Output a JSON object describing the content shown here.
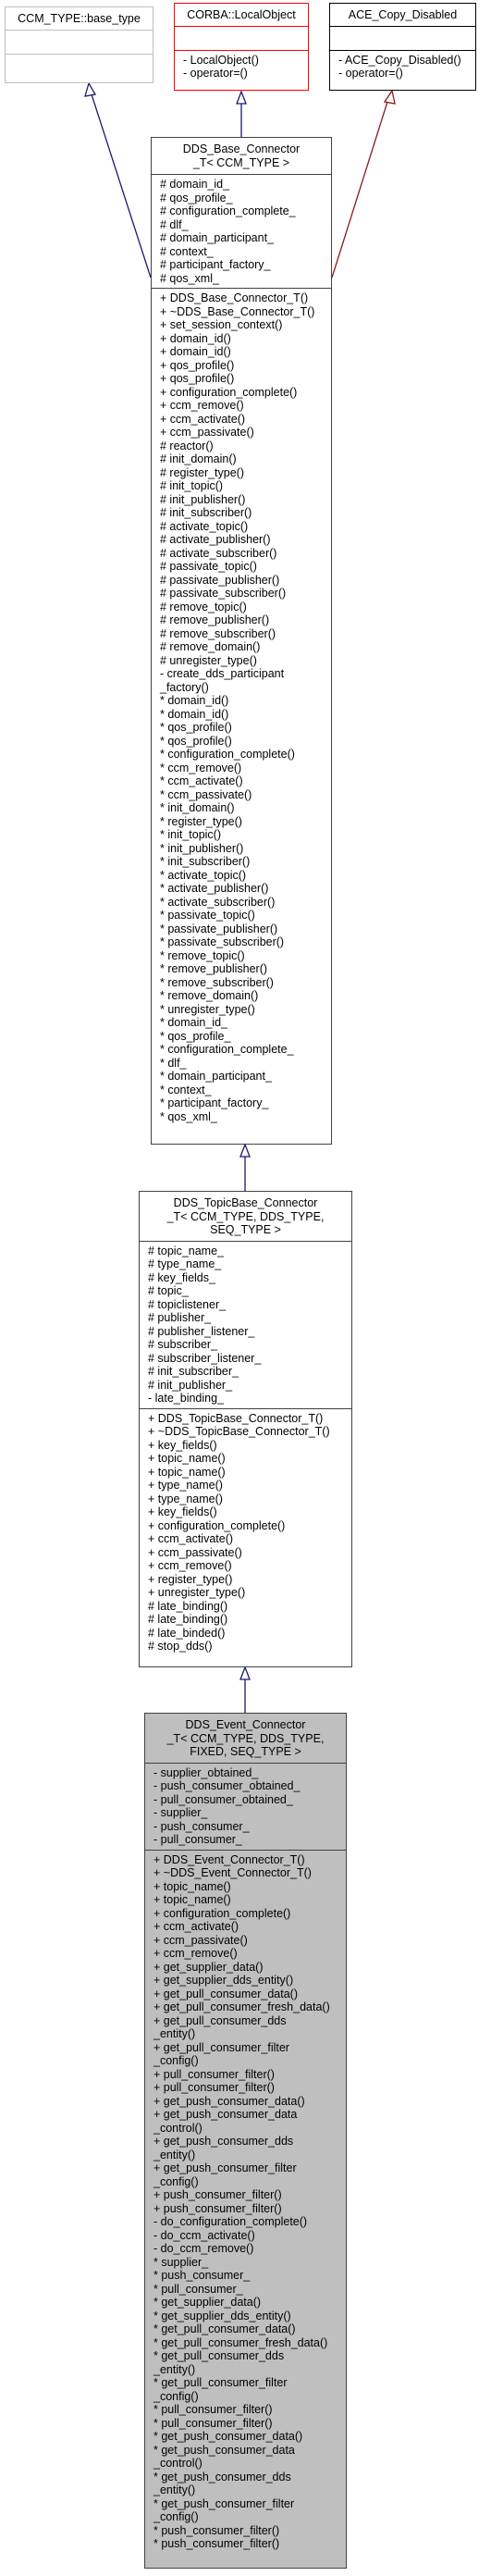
{
  "classes": {
    "base_type": {
      "title": "CCM_TYPE::base_type",
      "attributes": [],
      "methods": []
    },
    "local_object": {
      "title": "CORBA::LocalObject",
      "attributes": [],
      "methods": [
        "- LocalObject()",
        "- operator=()"
      ]
    },
    "copy_disabled": {
      "title": "ACE_Copy_Disabled",
      "attributes": [],
      "methods": [
        "- ACE_Copy_Disabled()",
        "- operator=()"
      ]
    },
    "base_connector": {
      "title": "DDS_Base_Connector\n_T< CCM_TYPE >",
      "attributes": [
        "# domain_id_",
        "# qos_profile_",
        "# configuration_complete_",
        "# dlf_",
        "# domain_participant_",
        "# context_",
        "# participant_factory_",
        "# qos_xml_"
      ],
      "methods": [
        "+ DDS_Base_Connector_T()",
        "+ ~DDS_Base_Connector_T()",
        "+ set_session_context()",
        "+ domain_id()",
        "+ domain_id()",
        "+ qos_profile()",
        "+ qos_profile()",
        "+ configuration_complete()",
        "+ ccm_remove()",
        "+ ccm_activate()",
        "+ ccm_passivate()",
        "# reactor()",
        "# init_domain()",
        "# register_type()",
        "# init_topic()",
        "# init_publisher()",
        "# init_subscriber()",
        "# activate_topic()",
        "# activate_publisher()",
        "# activate_subscriber()",
        "# passivate_topic()",
        "# passivate_publisher()",
        "# passivate_subscriber()",
        "# remove_topic()",
        "# remove_publisher()",
        "# remove_subscriber()",
        "# remove_domain()",
        "# unregister_type()",
        "- create_dds_participant",
        "_factory()",
        "* domain_id()",
        "* domain_id()",
        "* qos_profile()",
        "* qos_profile()",
        "* configuration_complete()",
        "* ccm_remove()",
        "* ccm_activate()",
        "* ccm_passivate()",
        "* init_domain()",
        "* register_type()",
        "* init_topic()",
        "* init_publisher()",
        "* init_subscriber()",
        "* activate_topic()",
        "* activate_publisher()",
        "* activate_subscriber()",
        "* passivate_topic()",
        "* passivate_publisher()",
        "* passivate_subscriber()",
        "* remove_topic()",
        "* remove_publisher()",
        "* remove_subscriber()",
        "* remove_domain()",
        "* unregister_type()",
        "* domain_id_",
        "* qos_profile_",
        "* configuration_complete_",
        "* dlf_",
        "* domain_participant_",
        "* context_",
        "* participant_factory_",
        "* qos_xml_"
      ]
    },
    "topic_base_connector": {
      "title": "DDS_TopicBase_Connector\n_T< CCM_TYPE, DDS_TYPE,\nSEQ_TYPE >",
      "attributes": [
        "# topic_name_",
        "# type_name_",
        "# key_fields_",
        "# topic_",
        "# topiclistener_",
        "# publisher_",
        "# publisher_listener_",
        "# subscriber_",
        "# subscriber_listener_",
        "# init_subscriber_",
        "# init_publisher_",
        "- late_binding_"
      ],
      "methods": [
        "+ DDS_TopicBase_Connector_T()",
        "+ ~DDS_TopicBase_Connector_T()",
        "+ key_fields()",
        "+ topic_name()",
        "+ topic_name()",
        "+ type_name()",
        "+ type_name()",
        "+ key_fields()",
        "+ configuration_complete()",
        "+ ccm_activate()",
        "+ ccm_passivate()",
        "+ ccm_remove()",
        "+ register_type()",
        "+ unregister_type()",
        "# late_binding()",
        "# late_binding()",
        "# late_binded()",
        "# stop_dds()"
      ]
    },
    "event_connector": {
      "title": "DDS_Event_Connector\n_T< CCM_TYPE, DDS_TYPE,\nFIXED, SEQ_TYPE >",
      "attributes": [
        "- supplier_obtained_",
        "- push_consumer_obtained_",
        "- pull_consumer_obtained_",
        "- supplier_",
        "- push_consumer_",
        "- pull_consumer_"
      ],
      "methods": [
        "+ DDS_Event_Connector_T()",
        "+ ~DDS_Event_Connector_T()",
        "+ topic_name()",
        "+ topic_name()",
        "+ configuration_complete()",
        "+ ccm_activate()",
        "+ ccm_passivate()",
        "+ ccm_remove()",
        "+ get_supplier_data()",
        "+ get_supplier_dds_entity()",
        "+ get_pull_consumer_data()",
        "+ get_pull_consumer_fresh_data()",
        "+ get_pull_consumer_dds",
        "_entity()",
        "+ get_pull_consumer_filter",
        "_config()",
        "+ pull_consumer_filter()",
        "+ pull_consumer_filter()",
        "+ get_push_consumer_data()",
        "+ get_push_consumer_data",
        "_control()",
        "+ get_push_consumer_dds",
        "_entity()",
        "+ get_push_consumer_filter",
        "_config()",
        "+ push_consumer_filter()",
        "+ push_consumer_filter()",
        "- do_configuration_complete()",
        "- do_ccm_activate()",
        "- do_ccm_remove()",
        "* supplier_",
        "* push_consumer_",
        "* pull_consumer_",
        "* get_supplier_data()",
        "* get_supplier_dds_entity()",
        "* get_pull_consumer_data()",
        "* get_pull_consumer_fresh_data()",
        "* get_pull_consumer_dds",
        "_entity()",
        "* get_pull_consumer_filter",
        "_config()",
        "* pull_consumer_filter()",
        "* pull_consumer_filter()",
        "* get_push_consumer_data()",
        "* get_push_consumer_data",
        "_control()",
        "* get_push_consumer_dds",
        "_entity()",
        "* get_push_consumer_filter",
        "_config()",
        "* push_consumer_filter()",
        "* push_consumer_filter()"
      ]
    }
  },
  "edge_colors": {
    "public_inheritance": "#191970",
    "private_inheritance": "#8b1a1a"
  },
  "box_colors": {
    "external": "#bfbfbf",
    "local_object": "#ff0000",
    "copy_disabled": "#000000",
    "normal": "#404040",
    "highlight_fill": "#bfbfbf"
  }
}
